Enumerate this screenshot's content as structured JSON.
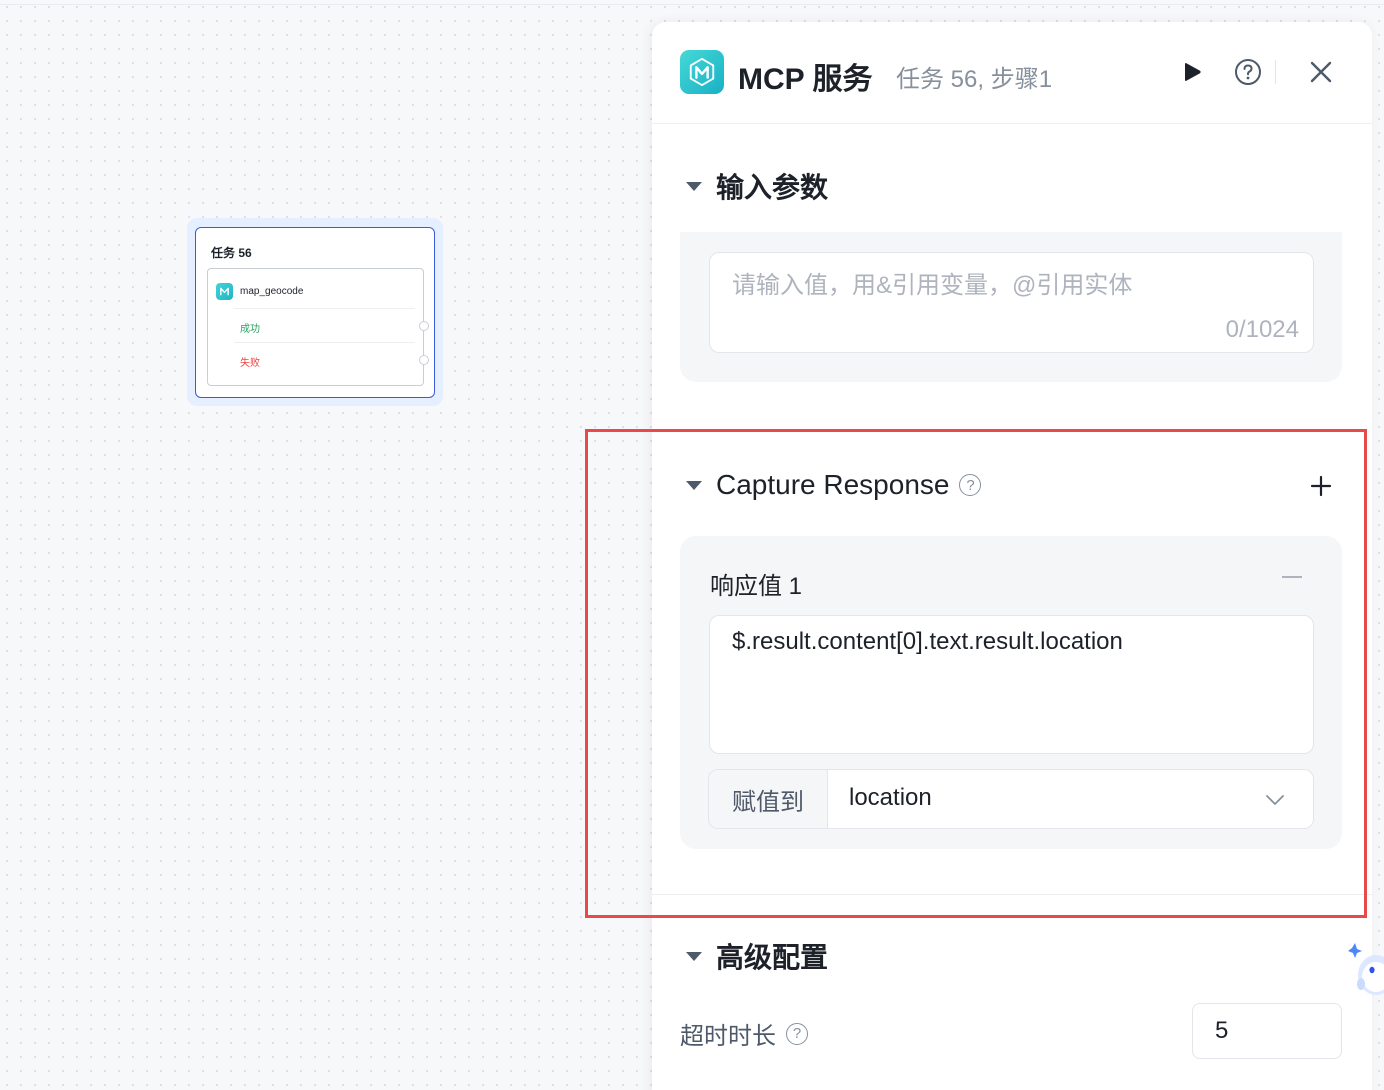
{
  "canvas": {
    "node": {
      "title": "任务 56",
      "tool": "map_geocode",
      "success_label": "成功",
      "fail_label": "失败"
    }
  },
  "panel": {
    "title": "MCP 服务",
    "subtitle": "任务 56, 步骤1",
    "input_section": {
      "title": "输入参数",
      "placeholder": "请输入值，用&引用变量，@引用实体",
      "counter": "0/1024"
    },
    "capture_section": {
      "title": "Capture Response",
      "help_icon": "?",
      "add_icon": "+",
      "response": {
        "title": "响应值 1",
        "expression": "$.result.content[0].text.result.location",
        "assign_label": "赋值到",
        "assign_value": "location"
      }
    },
    "advanced_section": {
      "title": "高级配置",
      "timeout_label": "超时时长",
      "timeout_value": "5"
    }
  },
  "colors": {
    "accent": "#3b5bdb",
    "brand_teal": "#2cc3cf",
    "success": "#23a55a",
    "fail": "#f04343",
    "highlight": "#e8494b"
  }
}
